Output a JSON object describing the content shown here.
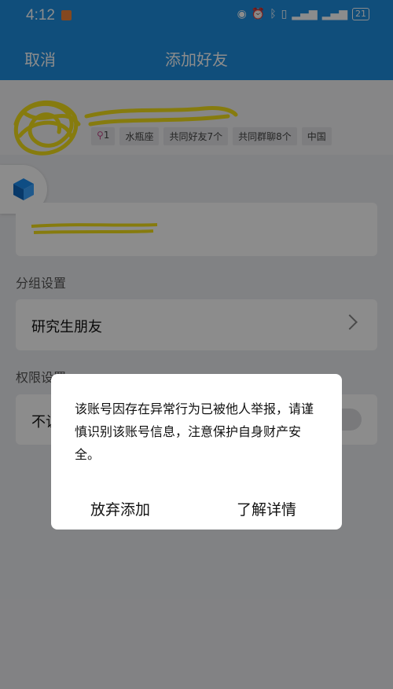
{
  "status_bar": {
    "time": "4:12",
    "battery": "21"
  },
  "nav": {
    "cancel_label": "取消",
    "title": "添加好友"
  },
  "profile": {
    "tags": [
      {
        "icon": "search-icon",
        "text": "1"
      },
      {
        "text": "水瓶座"
      },
      {
        "text": "共同好友7个"
      },
      {
        "text": "共同群聊8个"
      },
      {
        "text": "中国"
      }
    ]
  },
  "group": {
    "section_label": "分组设置",
    "value": "研究生朋友"
  },
  "permission": {
    "section_label": "权限设置",
    "row_label": "不让"
  },
  "dialog": {
    "message": "该账号因存在异常行为已被他人举报，请谨慎识别该账号信息，注意保护自身财产安全。",
    "abandon_label": "放弃添加",
    "details_label": "了解详情"
  },
  "colors": {
    "accent": "#1e8fe0",
    "scribble": "#f5e11b"
  }
}
